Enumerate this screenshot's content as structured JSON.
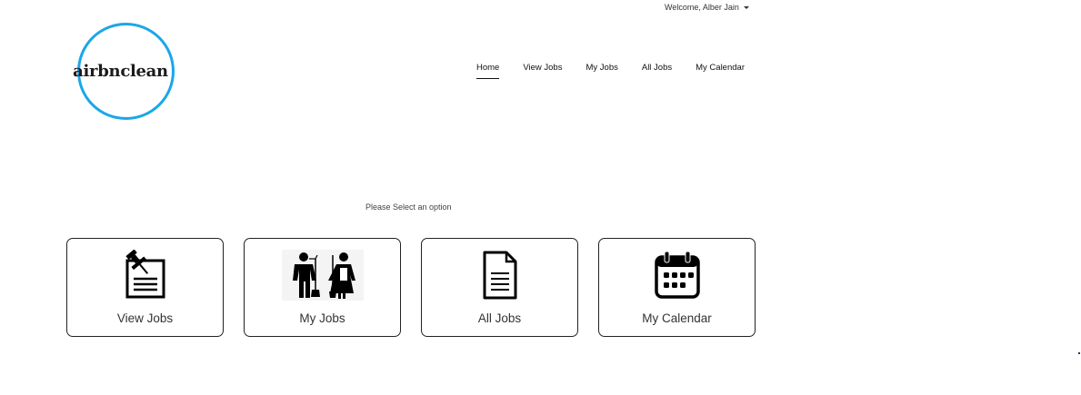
{
  "header": {
    "welcome_text": "Welcome, Alber Jain",
    "logo_text": "airbnclean",
    "logo_color": "#1aa7e8"
  },
  "nav": {
    "items": [
      {
        "label": "Home",
        "active": true
      },
      {
        "label": "View Jobs"
      },
      {
        "label": "My Jobs"
      },
      {
        "label": "All Jobs"
      },
      {
        "label": "My Calendar"
      }
    ]
  },
  "main": {
    "prompt": "Please Select an option",
    "tiles": [
      {
        "label": "View Jobs",
        "icon": "pinned-note-icon"
      },
      {
        "label": "My Jobs",
        "icon": "cleaning-staff-icon"
      },
      {
        "label": "All Jobs",
        "icon": "document-icon"
      },
      {
        "label": "My Calendar",
        "icon": "calendar-icon"
      }
    ]
  }
}
